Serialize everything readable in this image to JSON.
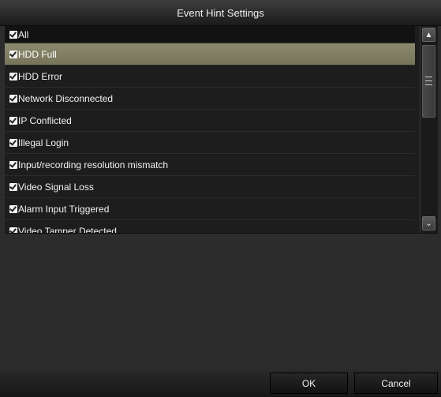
{
  "dialog": {
    "title": "Event Hint Settings"
  },
  "list": {
    "header_label": "All",
    "items": [
      {
        "label": "HDD Full",
        "checked": true,
        "selected": true
      },
      {
        "label": "HDD Error",
        "checked": true
      },
      {
        "label": "Network Disconnected",
        "checked": true
      },
      {
        "label": "IP Conflicted",
        "checked": true
      },
      {
        "label": "Illegal Login",
        "checked": true
      },
      {
        "label": "Input/recording resolution mismatch",
        "checked": true
      },
      {
        "label": "Video Signal Loss",
        "checked": true
      },
      {
        "label": "Alarm Input Triggered",
        "checked": true
      },
      {
        "label": "Video Tamper Detected",
        "checked": true
      }
    ]
  },
  "scrollbar": {
    "up_icon": "▲",
    "down_icon": "⌄"
  },
  "footer": {
    "ok_label": "OK",
    "cancel_label": "Cancel"
  },
  "colors": {
    "selected_row": "#8b8a6e",
    "background": "#2c2c2c",
    "list_background": "#1d1d1d"
  }
}
